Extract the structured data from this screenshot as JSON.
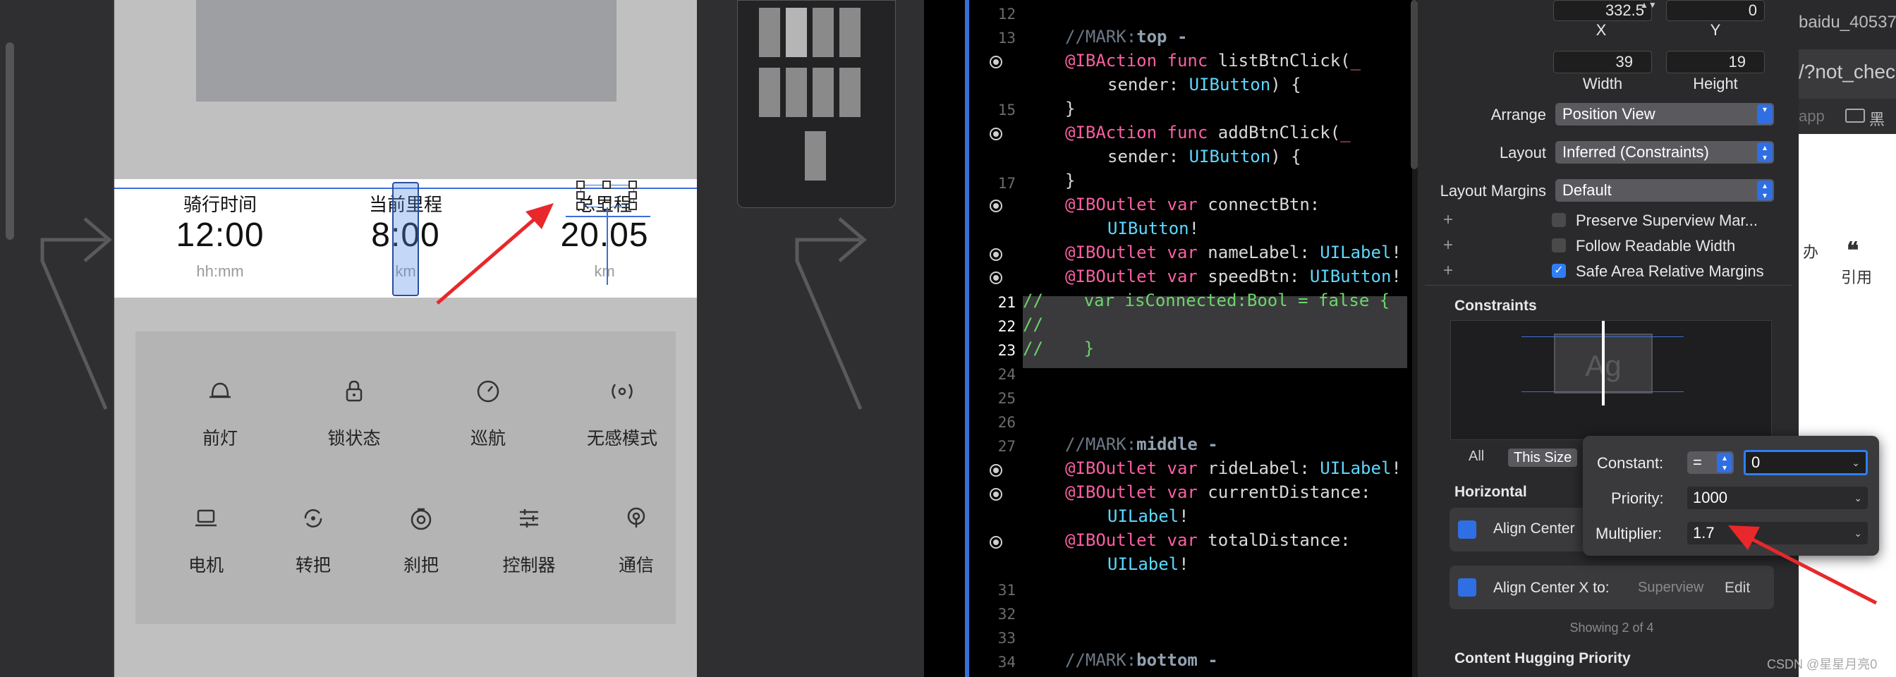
{
  "phone_screen": {
    "stats": [
      {
        "label": "骑行时间",
        "value": "12:00",
        "unit": "hh:mm"
      },
      {
        "label": "当前里程",
        "value": "8:00",
        "unit": "km"
      },
      {
        "label": "总里程",
        "value": "20.05",
        "unit": "km"
      }
    ],
    "functions_row1": [
      "前灯",
      "锁状态",
      "巡航",
      "无感模式"
    ],
    "functions_row2": [
      "电机",
      "转把",
      "刹把",
      "控制器",
      "通信"
    ]
  },
  "code_editor": {
    "line_numbers": [
      "12",
      "13",
      "",
      "15",
      "",
      "17",
      "",
      "",
      "",
      "",
      "21",
      "22",
      "23",
      "24",
      "25",
      "26",
      "27",
      "",
      "",
      "",
      "",
      "31",
      "32",
      "33",
      "34"
    ],
    "lines": [
      {
        "n": "12",
        "text": ""
      },
      {
        "n": "13",
        "comment": "//MARK:",
        "mark": "top -"
      },
      {
        "n": "",
        "pre": "@IBAction ",
        "kw": "func ",
        "name": "listBtnClick(_"
      },
      {
        "n": "",
        "text": "    sender: ",
        "type": "UIButton",
        ") {": ""
      },
      {
        "n": "15",
        "text": "}"
      },
      {
        "n": "",
        "pre": "@IBAction ",
        "kw": "func ",
        "name": "addBtnClick(_"
      },
      {
        "n": "",
        "text": "    sender: ",
        "type": "UIButton"
      },
      {
        "n": "17",
        "text": "}"
      },
      {
        "n": "",
        "pre": "@IBOutlet ",
        "kw": "var ",
        "name": "connectBtn:"
      },
      {
        "n": "",
        "type": "UIButton!"
      },
      {
        "n": "",
        "pre": "@IBOutlet ",
        "kw": "var ",
        "name": "nameLabel: ",
        "type": "UILabel!"
      },
      {
        "n": "",
        "pre": "@IBOutlet ",
        "kw": "var ",
        "name": "speedBtn: ",
        "type": "UIButton!"
      },
      {
        "n": "21",
        "text": "//    var isConnected:Bool = false {"
      },
      {
        "n": "22",
        "text": "//"
      },
      {
        "n": "23",
        "text": "//    }"
      },
      {
        "n": "24",
        "text": ""
      },
      {
        "n": "25",
        "text": ""
      },
      {
        "n": "26",
        "text": ""
      },
      {
        "n": "27",
        "comment": "//MARK:",
        "mark": "middle -"
      },
      {
        "n": "",
        "pre": "@IBOutlet ",
        "kw": "var ",
        "name": "rideLabel: ",
        "type": "UILabel!"
      },
      {
        "n": "",
        "pre": "@IBOutlet ",
        "kw": "var ",
        "name": "currentDistance:"
      },
      {
        "n": "",
        "type": "UILabel!"
      },
      {
        "n": "",
        "pre": "@IBOutlet ",
        "kw": "var ",
        "name": "totalDistance:"
      },
      {
        "n": "",
        "type": "UILabel!"
      },
      {
        "n": "31",
        "text": ""
      },
      {
        "n": "32",
        "text": ""
      },
      {
        "n": "33",
        "text": ""
      },
      {
        "n": "34",
        "comment": "//MARK:",
        "mark": "bottom -"
      }
    ]
  },
  "inspector": {
    "x_value": "332.5",
    "y_value": "0",
    "x_label": "X",
    "y_label": "Y",
    "width_value": "39",
    "height_value": "19",
    "width_label": "Width",
    "height_label": "Height",
    "arrange_label": "Arrange",
    "arrange_value": "Position View",
    "layout_label": "Layout",
    "layout_value": "Inferred (Constraints)",
    "margins_label": "Layout Margins",
    "margins_value": "Default",
    "checks": [
      {
        "label": "Preserve Superview Mar...",
        "checked": false
      },
      {
        "label": "Follow Readable Width",
        "checked": false
      },
      {
        "label": "Safe Area Relative Margins",
        "checked": true
      }
    ],
    "plus": "+",
    "constraints_title": "Constraints",
    "preview_text": "Ag",
    "tab_all": "All",
    "tab_this_size": "This Size",
    "horizontal_title": "Horizontal",
    "constraint1": "Align Center",
    "constraint2": "Align Center X to:",
    "constraint2_target": "Superview",
    "edit_label": "Edit",
    "showing": "Showing 2 of 4",
    "hugging_title": "Content Hugging Priority"
  },
  "popover": {
    "constant_label": "Constant:",
    "relation": "=",
    "constant_value": "0",
    "priority_label": "Priority:",
    "priority_value": "1000",
    "multiplier_label": "Multiplier:",
    "multiplier_value": "1.7"
  },
  "right_strip": {
    "url_fragment1": "baidu_40537",
    "url_fragment2": "/?not_chec",
    "app_text": "app",
    "folder_text": "黑",
    "quote_label": "引用",
    "small_text": "办",
    "watermark": "CSDN @星星月亮0"
  },
  "colors": {
    "accent": "#2f7ef6",
    "arrow": "#e8282b",
    "kw": "#fc5fa3",
    "type": "#5dd8ff"
  }
}
